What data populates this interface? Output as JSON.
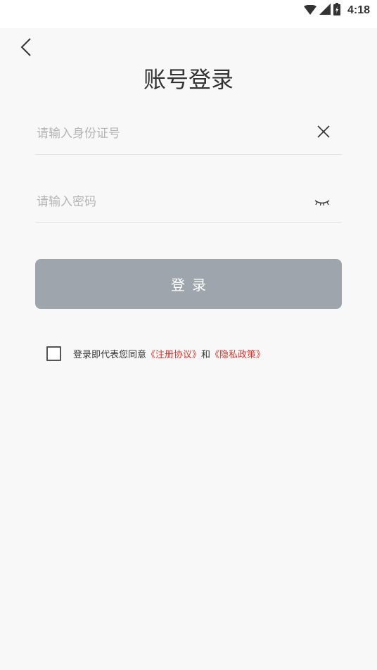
{
  "status_bar": {
    "time": "4:18",
    "icons": [
      "wifi-icon",
      "cellular-signal-icon",
      "battery-charging-icon"
    ]
  },
  "header": {
    "back_icon": "chevron-left-icon",
    "title": "账号登录"
  },
  "form": {
    "id_field": {
      "placeholder": "请输入身份证号",
      "value": "",
      "action_icon": "close-icon"
    },
    "password_field": {
      "placeholder": "请输入密码",
      "value": "",
      "action_icon": "eye-closed-icon"
    },
    "login_button_label": "登录"
  },
  "agreement": {
    "checked": false,
    "prefix": "登录即代表您同意",
    "terms_link": "《注册协议》",
    "conjunction": "和",
    "privacy_link": "《隐私政策》"
  },
  "colors": {
    "background": "#f8f8f8",
    "button": "#9ea5ad",
    "link": "#e0332b",
    "title": "#333333",
    "placeholder": "#b5b5b5"
  }
}
